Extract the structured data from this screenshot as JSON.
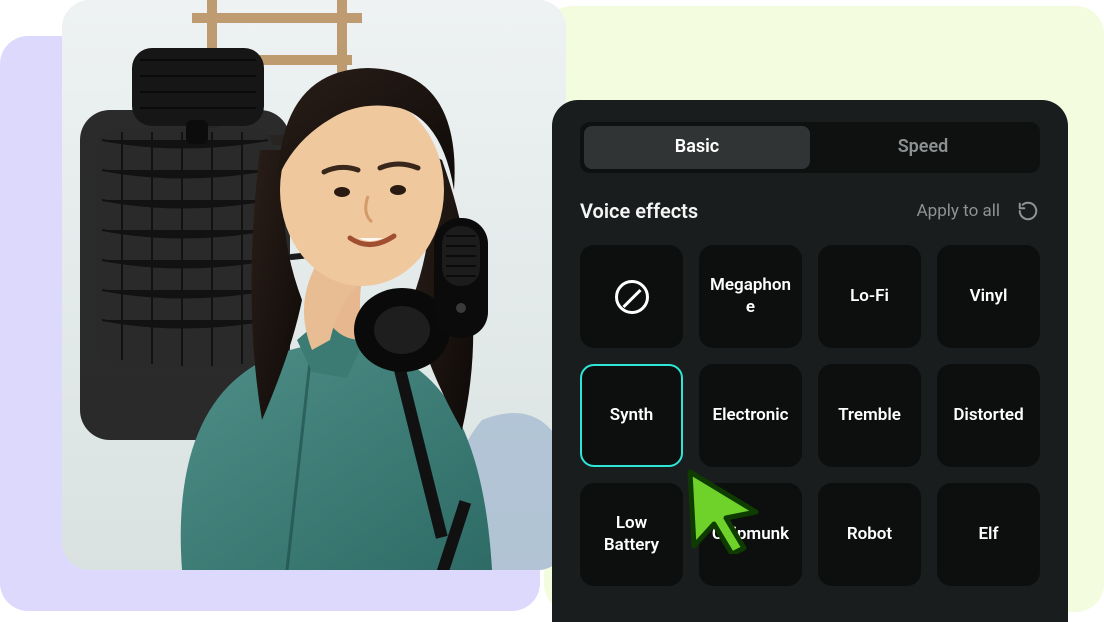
{
  "tabs": {
    "basic": "Basic",
    "speed": "Speed",
    "active": "basic"
  },
  "section": {
    "title": "Voice effects",
    "apply_all": "Apply to all"
  },
  "effects": [
    {
      "id": "none",
      "label": "",
      "icon": "none"
    },
    {
      "id": "megaphone",
      "label": "Megaphone"
    },
    {
      "id": "lofi",
      "label": "Lo-Fi"
    },
    {
      "id": "vinyl",
      "label": "Vinyl"
    },
    {
      "id": "synth",
      "label": "Synth",
      "selected": true
    },
    {
      "id": "electronic",
      "label": "Electronic"
    },
    {
      "id": "tremble",
      "label": "Tremble"
    },
    {
      "id": "distorted",
      "label": "Distorted"
    },
    {
      "id": "lowbattery",
      "label": "Low Battery"
    },
    {
      "id": "chipmunk",
      "label": "Chipmunk"
    },
    {
      "id": "robot",
      "label": "Robot"
    },
    {
      "id": "elf",
      "label": "Elf"
    }
  ],
  "colors": {
    "accent": "#2ee6d6",
    "panel": "#1a1d1d",
    "tile": "#0d0f0f",
    "cursor_fill": "#6fd22b",
    "cursor_stroke": "#0e3c00"
  }
}
